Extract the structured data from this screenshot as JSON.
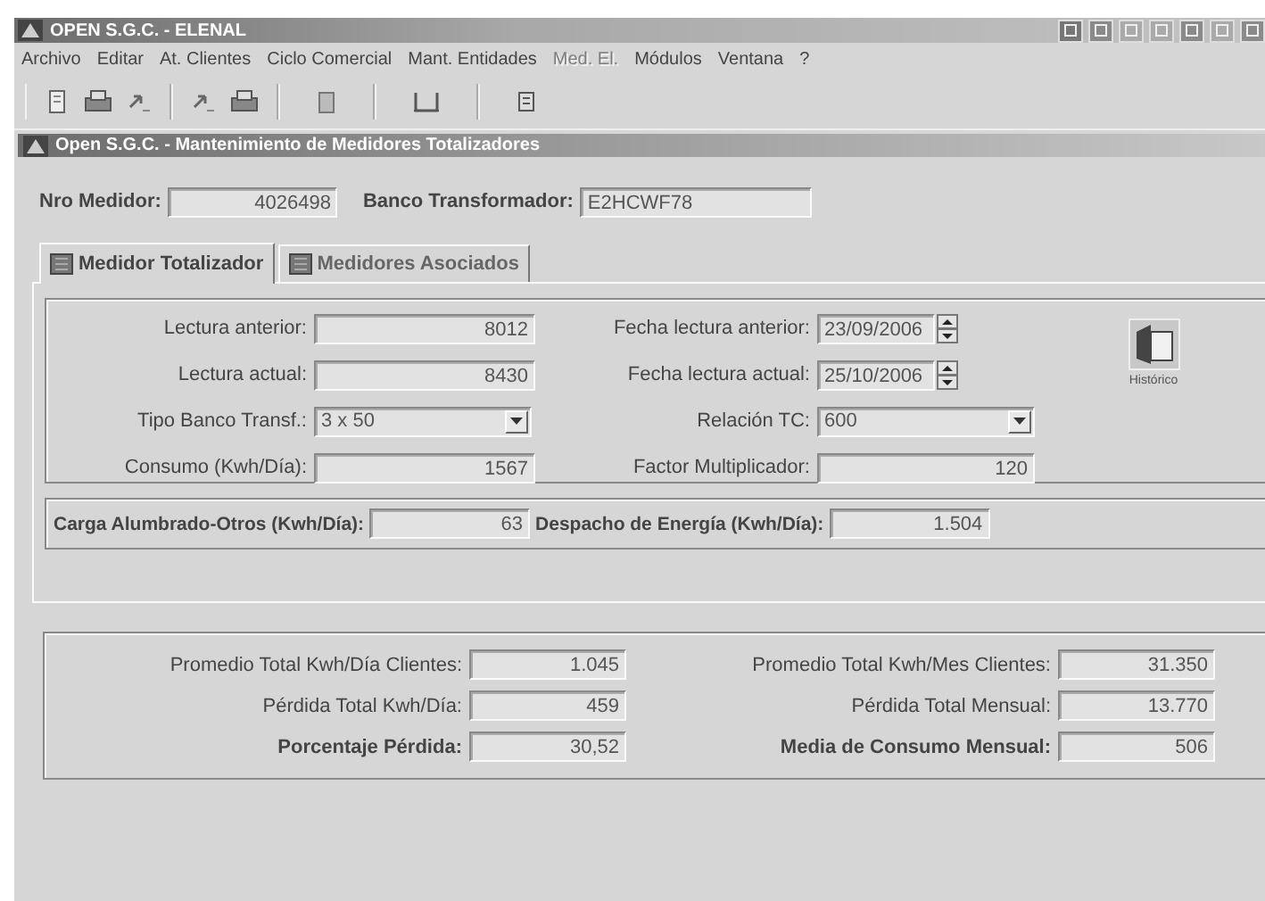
{
  "window": {
    "title": "OPEN S.G.C. - ELENAL"
  },
  "menu": [
    {
      "label": "Archivo",
      "disabled": false
    },
    {
      "label": "Editar",
      "disabled": false
    },
    {
      "label": "At. Clientes",
      "disabled": false
    },
    {
      "label": "Ciclo Comercial",
      "disabled": false
    },
    {
      "label": "Mant. Entidades",
      "disabled": false
    },
    {
      "label": "Med. El.",
      "disabled": true
    },
    {
      "label": "Módulos",
      "disabled": false
    },
    {
      "label": "Ventana",
      "disabled": false
    },
    {
      "label": "?",
      "disabled": false
    }
  ],
  "child_window": {
    "title": "Open S.G.C. - Mantenimiento de Medidores Totalizadores"
  },
  "header_fields": [
    {
      "label": "Nro Medidor:",
      "value": "4026498",
      "kind": "number"
    },
    {
      "label": "Banco Transformador:",
      "value": "E2HCWF78",
      "kind": "code"
    }
  ],
  "tabs": [
    {
      "label": "Medidor Totalizador",
      "selected": true
    },
    {
      "label": "Medidores Asociados",
      "selected": false
    }
  ],
  "readings_left": [
    {
      "kind": "text",
      "label": "Lectura anterior:",
      "value": "8012"
    },
    {
      "kind": "text",
      "label": "Lectura actual:",
      "value": "8430"
    },
    {
      "kind": "select",
      "label": "Tipo Banco Transf.:",
      "value": "3 x 50"
    },
    {
      "kind": "text",
      "label": "Consumo (Kwh/Día):",
      "value": "1567"
    }
  ],
  "readings_right": [
    {
      "kind": "date",
      "label": "Fecha lectura anterior:",
      "value": "23/09/2006"
    },
    {
      "kind": "date",
      "label": "Fecha lectura actual:",
      "value": "25/10/2006"
    },
    {
      "kind": "select",
      "label": "Relación TC:",
      "value": "600"
    },
    {
      "kind": "text",
      "label": "Factor Multiplicador:",
      "value": "120"
    }
  ],
  "history_button": {
    "label": "Histórico"
  },
  "energy": [
    {
      "label": "Carga Alumbrado-Otros (Kwh/Día):",
      "value": "63",
      "bold": true
    },
    {
      "label": "Despacho de Energía (Kwh/Día):",
      "value": "1.504",
      "bold": true
    }
  ],
  "summary_left": [
    {
      "label": "Promedio Total Kwh/Día Clientes:",
      "value": "1.045",
      "bold": false
    },
    {
      "label": "Pérdida Total Kwh/Día:",
      "value": "459",
      "bold": false
    },
    {
      "label": "Porcentaje Pérdida:",
      "value": "30,52",
      "bold": true
    }
  ],
  "summary_right": [
    {
      "label": "Promedio Total Kwh/Mes Clientes:",
      "value": "31.350",
      "bold": false
    },
    {
      "label": "Pérdida Total Mensual:",
      "value": "13.770",
      "bold": false
    },
    {
      "label": "Media de Consumo Mensual:",
      "value": "506",
      "bold": true
    }
  ]
}
